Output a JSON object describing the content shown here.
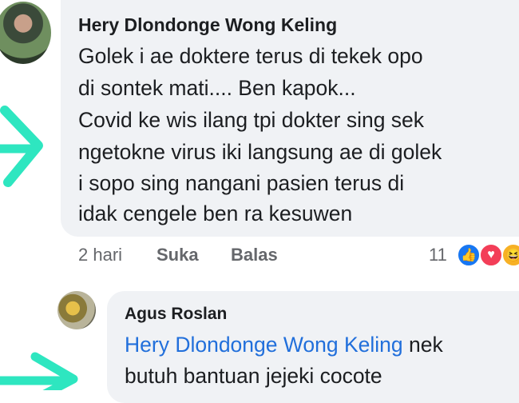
{
  "comment": {
    "author": "Hery Dlondonge Wong Keling",
    "lines": [
      "Golek i ae doktere terus di tekek opo",
      "di sontek mati....  Ben kapok...",
      "Covid ke wis ilang tpi dokter sing sek",
      "ngetokne virus iki langsung ae di golek",
      "i sopo sing nangani pasien  terus di",
      "idak cengele ben ra kesuwen"
    ],
    "time": "2 hari",
    "like_label": "Suka",
    "reply_label": "Balas",
    "reaction_count": "11",
    "reactions": [
      "like-icon",
      "love-icon",
      "haha-icon"
    ]
  },
  "reply": {
    "author": "Agus Roslan",
    "mention": "Hery Dlondonge Wong Keling",
    "line1_rest": "  nek",
    "line2": "butuh bantuan jejeki cocote"
  },
  "colors": {
    "bubble": "#f0f2f5",
    "mention": "#216fdb",
    "meta": "#65676b",
    "arrow": "#2ee6c0"
  }
}
